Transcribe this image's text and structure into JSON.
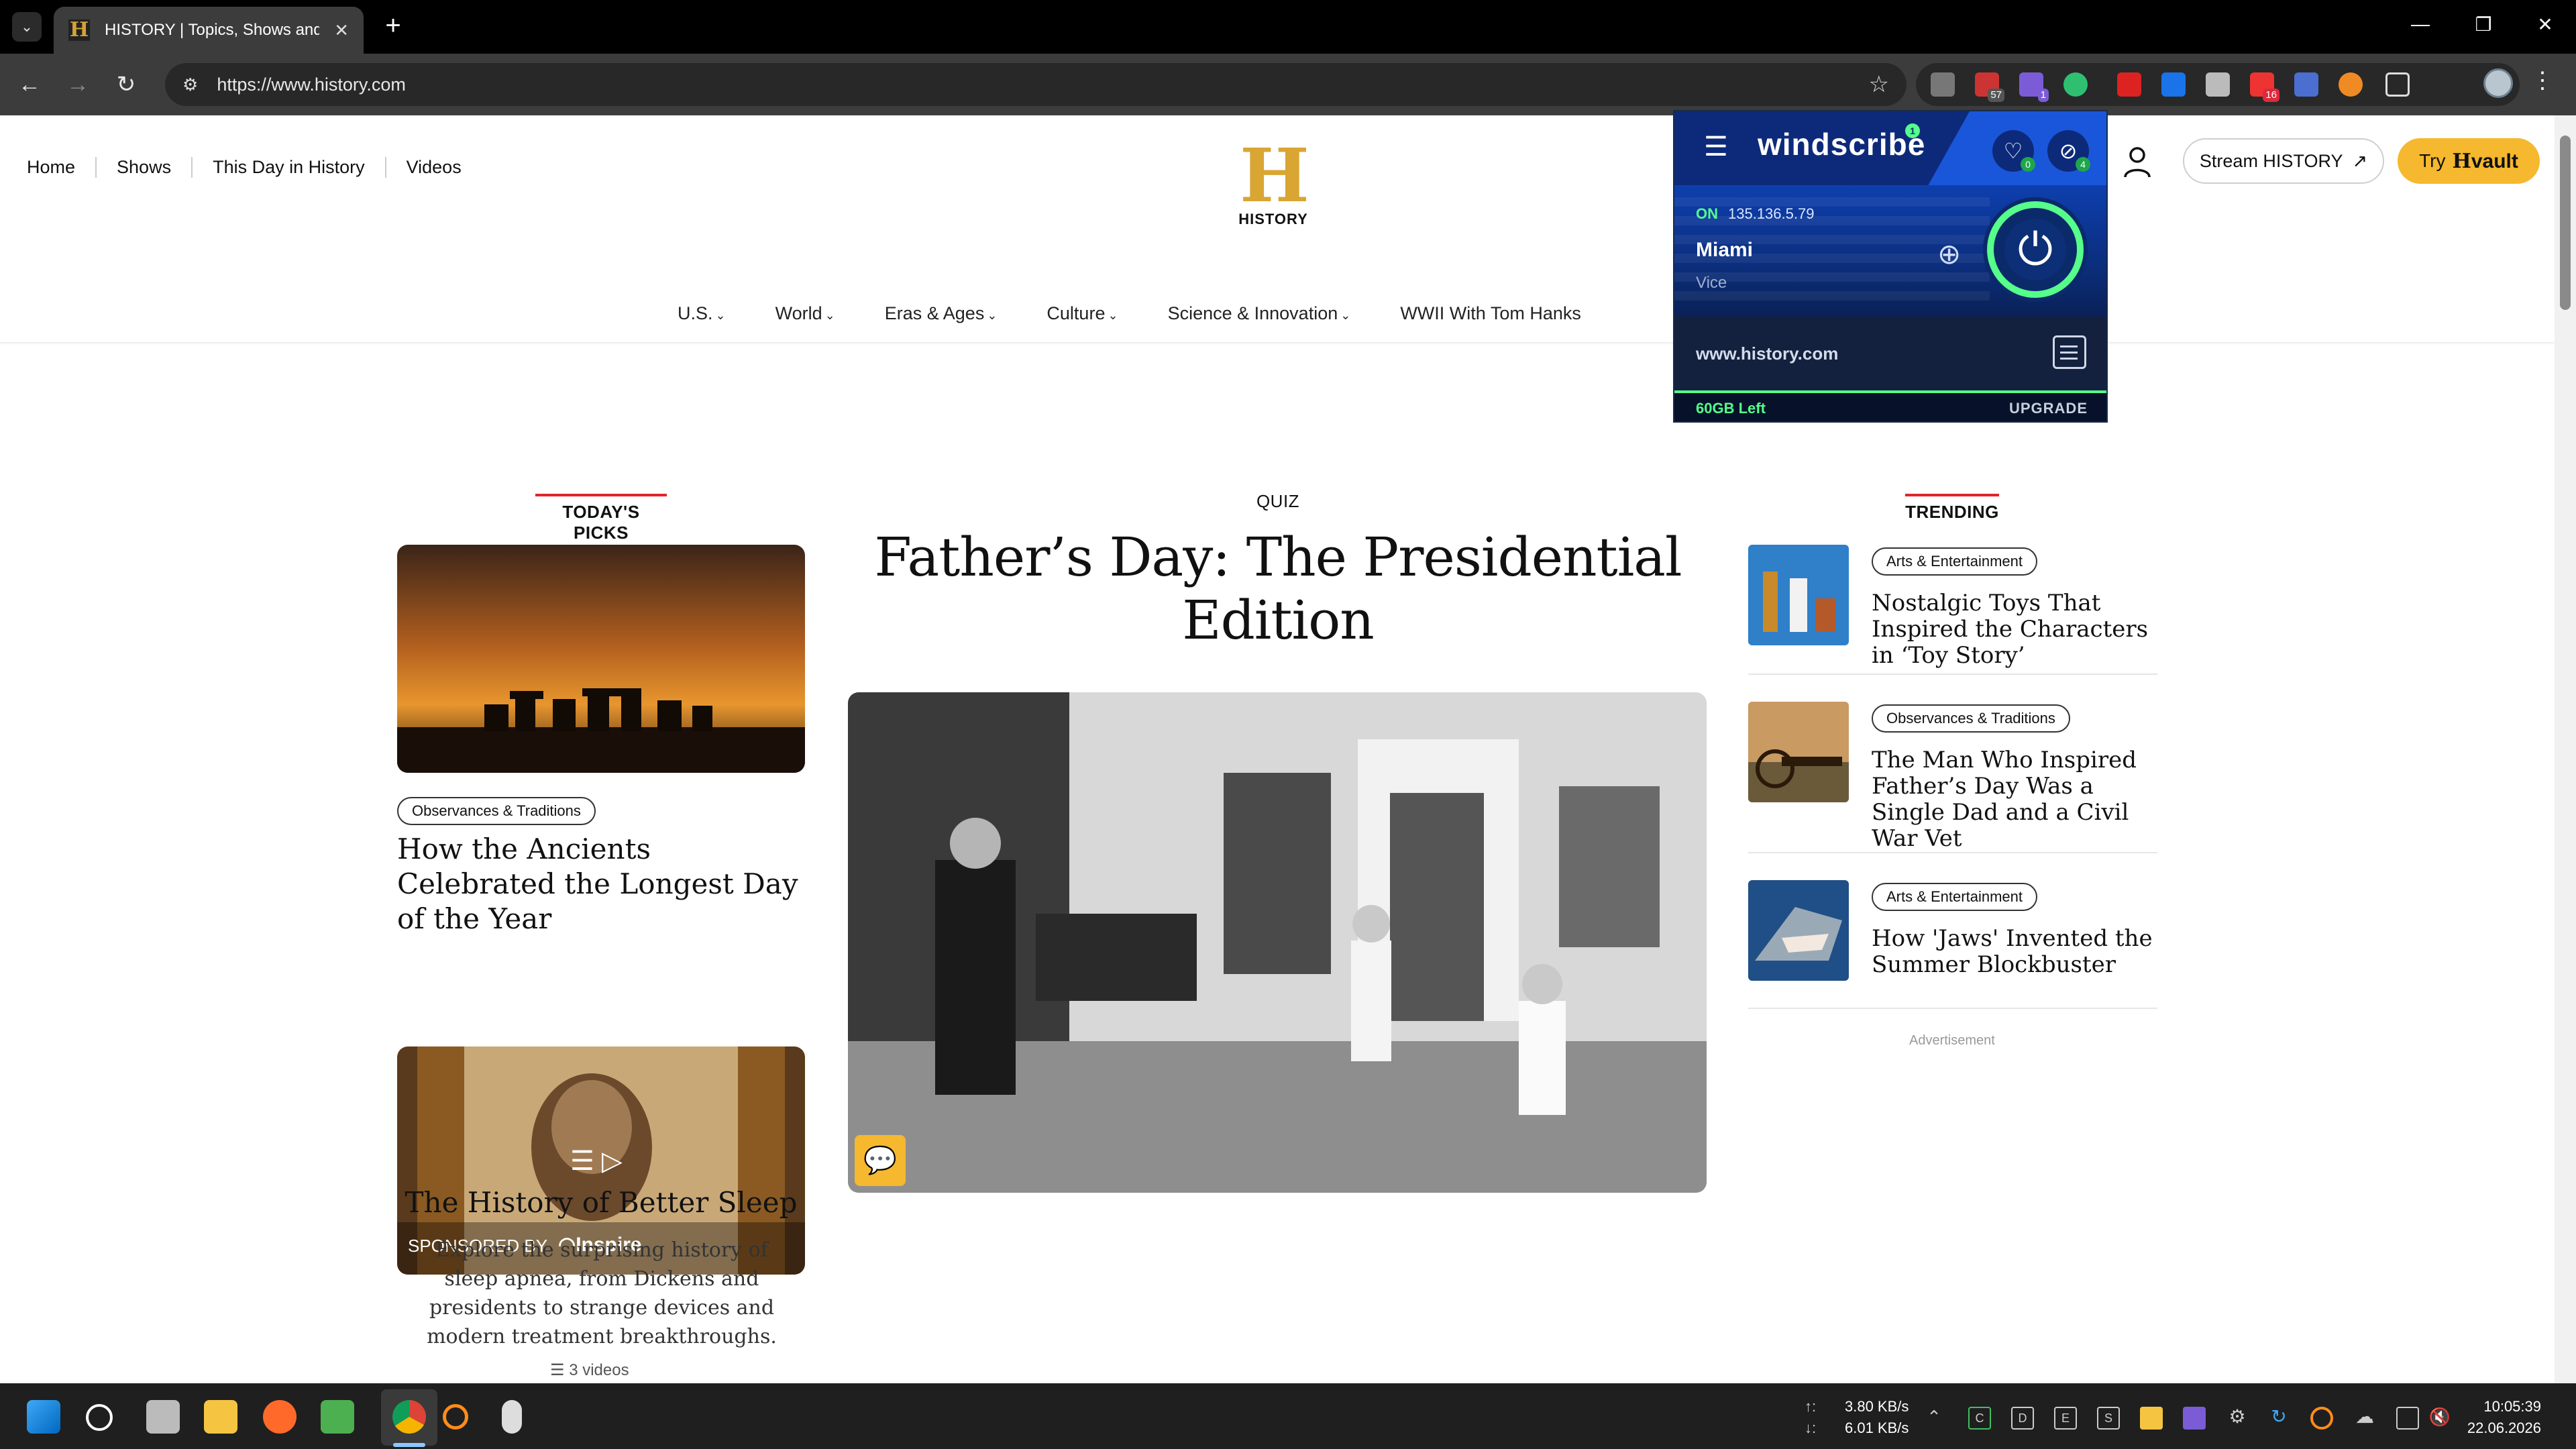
{
  "browser": {
    "tab": {
      "title": "HISTORY | Topics, Shows and Th",
      "favicon": "history-h-favicon"
    },
    "url": "https://www.history.com",
    "extension_badges": [
      "57",
      "1",
      "16"
    ]
  },
  "site": {
    "top_nav": [
      "Home",
      "Shows",
      "This Day in History",
      "Videos"
    ],
    "logo": {
      "letter": "H",
      "text": "HISTORY"
    },
    "stream_label": "Stream HISTORY",
    "try_label": "Try",
    "vault_label": "vault",
    "categories": [
      "U.S.",
      "World",
      "Eras & Ages",
      "Culture",
      "Science & Innovation",
      "WWII With Tom Hanks"
    ],
    "accent_color": "#f5b82e",
    "label_color": "#e0262c"
  },
  "todays_picks": {
    "label": "TODAY'S PICKS",
    "card1": {
      "tag": "Observances & Traditions",
      "title": "How the Ancients Celebrated the Longest Day of the Year"
    },
    "card2": {
      "sponsor_prefix": "SPONSORED BY",
      "sponsor": "Inspire",
      "title": "The History of Better Sleep",
      "description": "Explore the surprising history of sleep apnea, from Dickens and presidents to strange devices and modern treatment breakthroughs.",
      "videos": "3 videos"
    }
  },
  "feature": {
    "label": "QUIZ",
    "title": "Father’s Day: The Presidential Edition"
  },
  "trending": {
    "label": "TRENDING",
    "items": [
      {
        "tag": "Arts & Entertainment",
        "title": "Nostalgic Toys That Inspired the Characters in ‘Toy Story’"
      },
      {
        "tag": "Observances & Traditions",
        "title": "The Man Who Inspired Father’s Day Was a Single Dad and a Civil War Vet"
      },
      {
        "tag": "Arts & Entertainment",
        "title": "How 'Jaws' Invented the Summer Blockbuster"
      }
    ],
    "advertisement": "Advertisement"
  },
  "windscribe": {
    "brand": "windscribe",
    "logo_badge": "1",
    "fav_badge": "0",
    "block_badge": "4",
    "status": "ON",
    "ip": "135.136.5.79",
    "city": "Miami",
    "server": "Vice",
    "site": "www.history.com",
    "data_left": "60GB Left",
    "upgrade": "UPGRADE",
    "accent_color": "#55ff8a"
  },
  "taskbar": {
    "upload_speed": "3.80 KB/s",
    "download_speed": "6.01 KB/s",
    "time": "10:05:39",
    "date": "22.06.2026"
  }
}
